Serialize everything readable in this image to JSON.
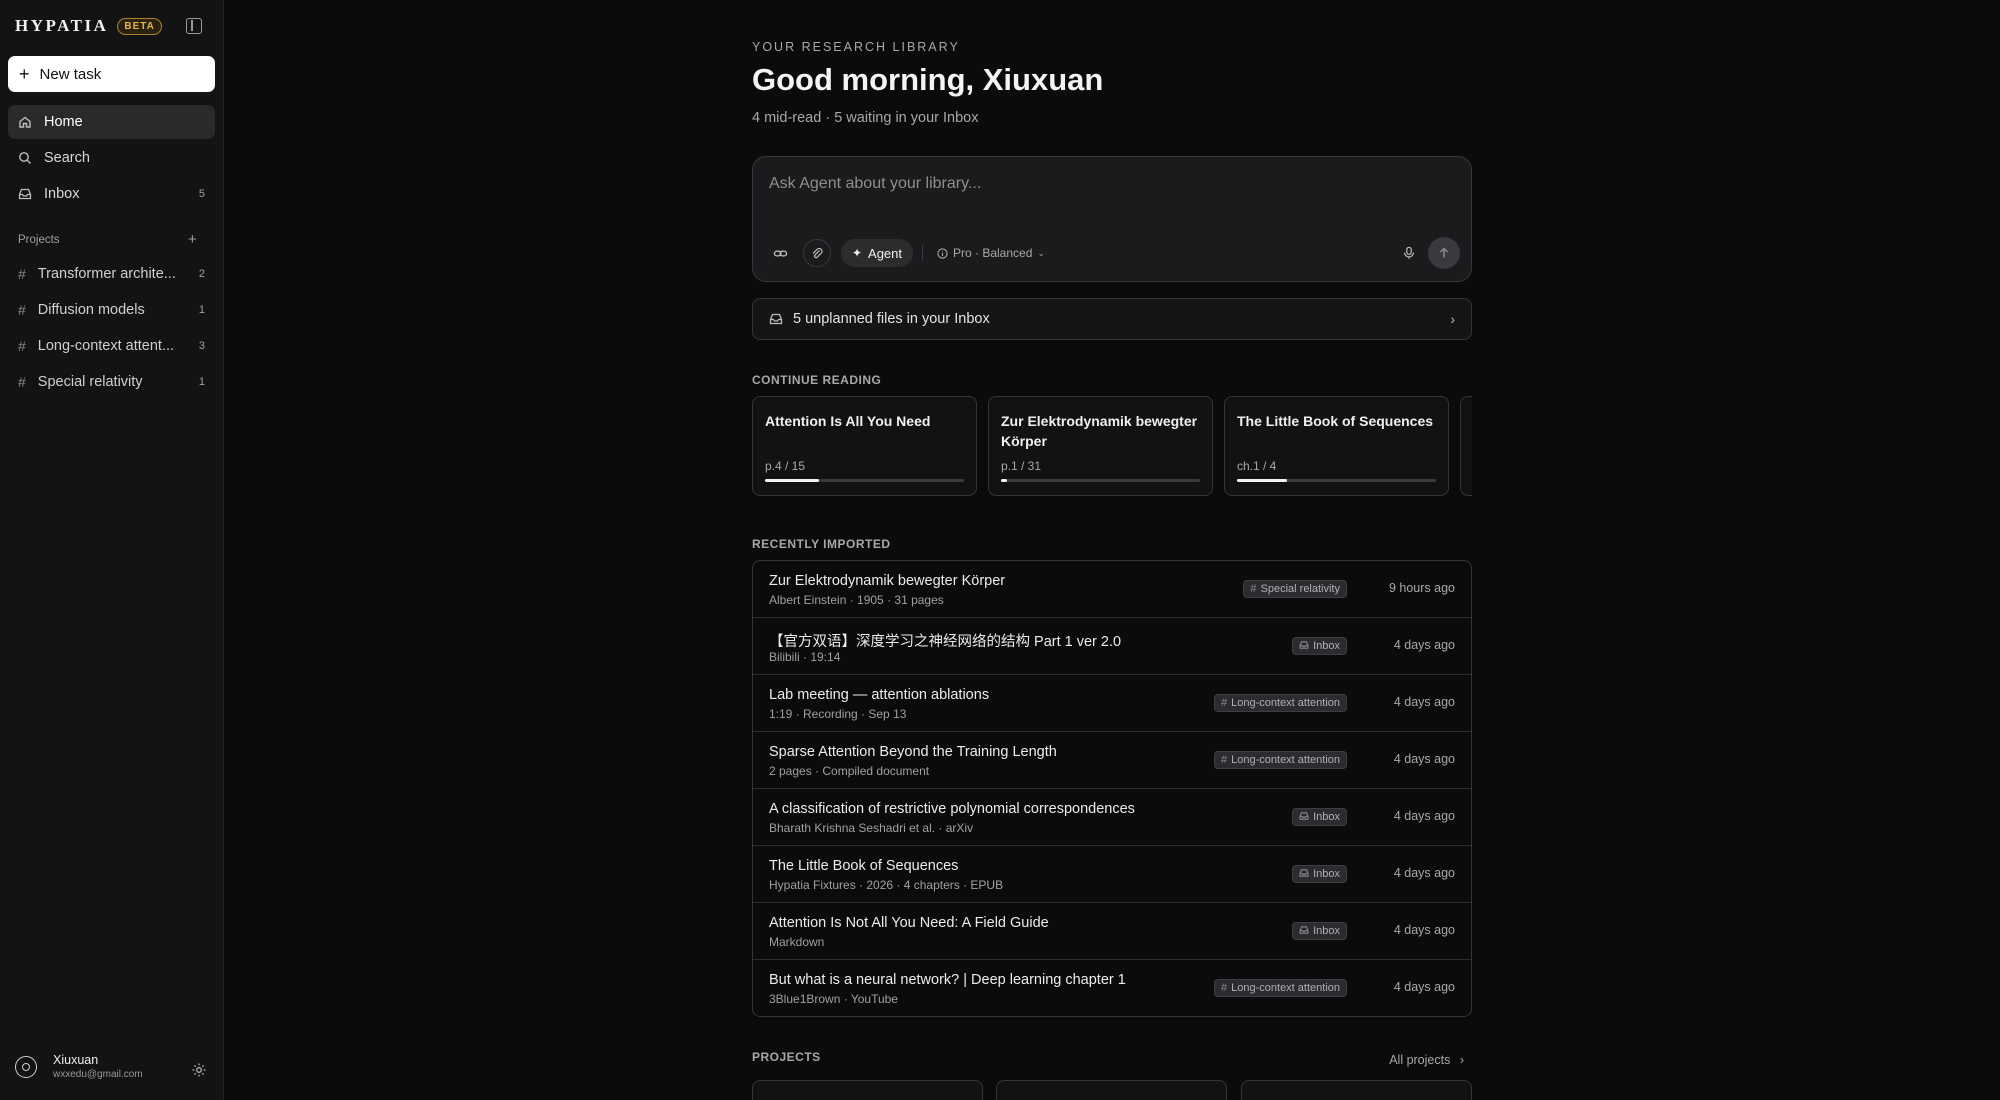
{
  "app": {
    "brand": "HYPATIA",
    "badge": "BETA"
  },
  "sidebar": {
    "new_task": "New task",
    "nav": [
      {
        "label": "Home",
        "icon": "home-icon",
        "active": true
      },
      {
        "label": "Search",
        "icon": "search-icon"
      },
      {
        "label": "Inbox",
        "icon": "inbox-icon",
        "count": "5"
      }
    ],
    "projects_label": "Projects",
    "projects": [
      {
        "name": "Transformer archite...",
        "count": "2"
      },
      {
        "name": "Diffusion models",
        "count": "1"
      },
      {
        "name": "Long-context attent...",
        "count": "3"
      },
      {
        "name": "Special relativity",
        "count": "1"
      }
    ],
    "user": {
      "name": "Xiuxuan",
      "email": "wxxedu@gmail.com"
    }
  },
  "main": {
    "eyebrow": "YOUR RESEARCH LIBRARY",
    "greeting": "Good morning, Xiuxuan",
    "subline": "4 mid-read · 5 waiting in your Inbox",
    "ask": {
      "placeholder": "Ask Agent about your library...",
      "agent_label": "Agent",
      "mode_label": "Pro · Balanced"
    },
    "inbox_banner": "5 unplanned files in your Inbox",
    "continue_label": "CONTINUE READING",
    "continue": [
      {
        "title": "Attention Is All You Need",
        "progress": "p.4 / 15",
        "fraction": 0.27
      },
      {
        "title": "Zur Elektrodynamik bewegter Körper",
        "progress": "p.1 / 31",
        "fraction": 0.03
      },
      {
        "title": "The Little Book of Sequences",
        "progress": "ch.1 / 4",
        "fraction": 0.25
      }
    ],
    "recent_label": "RECENTLY IMPORTED",
    "recent": [
      {
        "title": "Zur Elektrodynamik bewegter Körper",
        "meta": "Albert Einstein · 1905 · 31 pages",
        "tag": "Special relativity",
        "tag_icon": "#",
        "time": "9 hours ago"
      },
      {
        "title": "【官方双语】深度学习之神经网络的结构 Part 1 ver 2.0",
        "meta": "Bilibili · 19:14",
        "tag": "Inbox",
        "tag_icon": "inbox",
        "time": "4 days ago"
      },
      {
        "title": "Lab meeting — attention ablations",
        "meta": "1:19 · Recording · Sep 13",
        "tag": "Long-context attention",
        "tag_icon": "#",
        "time": "4 days ago"
      },
      {
        "title": "Sparse Attention Beyond the Training Length",
        "meta": "2 pages · Compiled document",
        "tag": "Long-context attention",
        "tag_icon": "#",
        "time": "4 days ago"
      },
      {
        "title": "A classification of restrictive polynomial correspondences",
        "meta": "Bharath Krishna Seshadri et al. · arXiv",
        "tag": "Inbox",
        "tag_icon": "inbox",
        "time": "4 days ago"
      },
      {
        "title": "The Little Book of Sequences",
        "meta": "Hypatia Fixtures · 2026 · 4 chapters · EPUB",
        "tag": "Inbox",
        "tag_icon": "inbox",
        "time": "4 days ago"
      },
      {
        "title": "Attention Is Not All You Need: A Field Guide",
        "meta": "Markdown",
        "tag": "Inbox",
        "tag_icon": "inbox",
        "time": "4 days ago"
      },
      {
        "title": "But what is a neural network? | Deep learning chapter 1",
        "meta": "3Blue1Brown · YouTube",
        "tag": "Long-context attention",
        "tag_icon": "#",
        "time": "4 days ago"
      }
    ],
    "projects_label": "PROJECTS",
    "all_projects": "All projects"
  },
  "colors": {
    "background": "#0b0b0c",
    "sidebar": "#131314",
    "accent_badge": "#e3b54a"
  }
}
